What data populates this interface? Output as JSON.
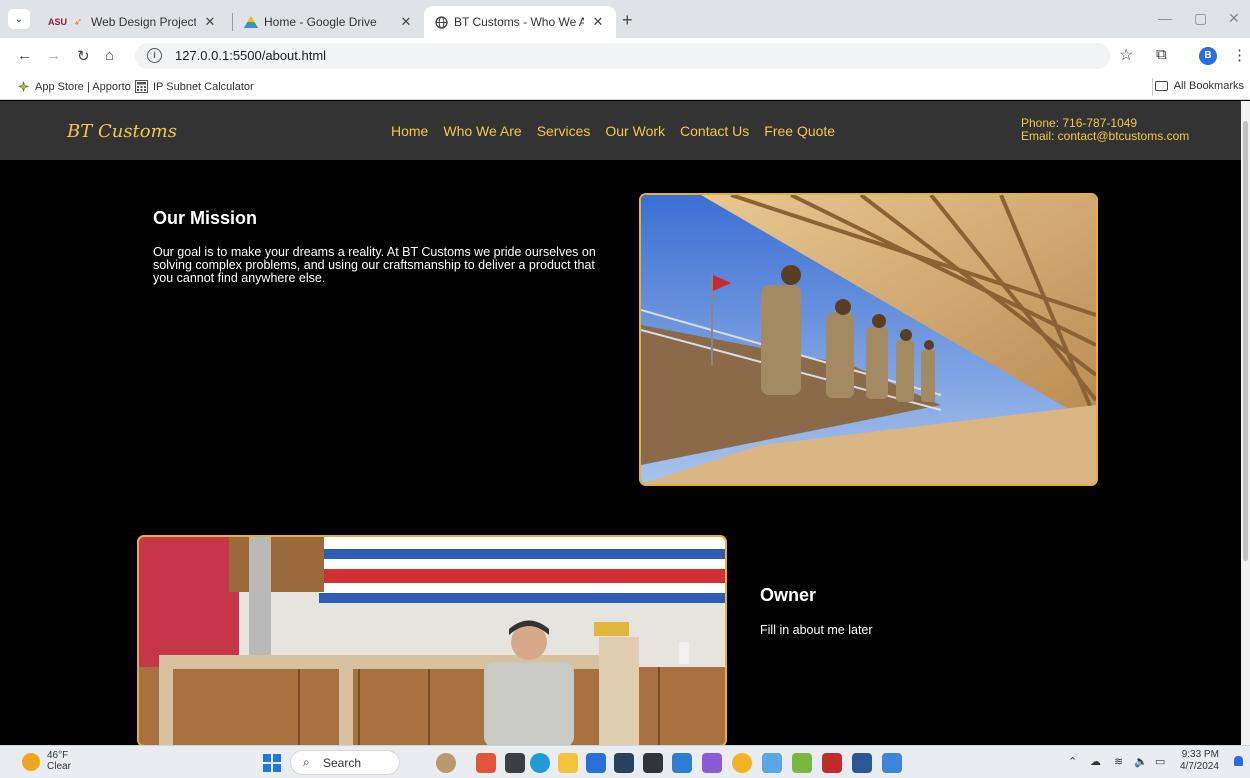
{
  "browser": {
    "tabs": [
      {
        "title": "Web Design Project - Proje",
        "favicon": "asu-logo-icon",
        "active": false
      },
      {
        "title": "Home - Google Drive",
        "favicon": "google-drive-icon",
        "active": false
      },
      {
        "title": "BT Customs - Who We Are",
        "favicon": "globe-icon",
        "active": true
      }
    ],
    "url": "127.0.0.1:5500/about.html",
    "profile_initial": "B",
    "bookmarks": [
      {
        "label": "App Store | Apporto",
        "icon": "apporto-icon"
      },
      {
        "label": "IP Subnet Calculator",
        "icon": "calculator-icon"
      }
    ],
    "all_bookmarks_label": "All Bookmarks",
    "asu_badge": "ASU"
  },
  "site": {
    "logo": "BT Customs",
    "nav": [
      "Home",
      "Who We Are",
      "Services",
      "Our Work",
      "Contact Us",
      "Free Quote"
    ],
    "phone": "Phone: 716-787-1049",
    "email": "Email: contact@btcustoms.com",
    "accent_color": "#f2c84b",
    "mission": {
      "title": "Our Mission",
      "text": "Our goal is to make your dreams a reality. At BT Customs we pride ourselves on solving complex problems, and using our craftsmanship to deliver a product that you cannot find anywhere else."
    },
    "owner": {
      "title": "Owner",
      "text": "Fill in about me later"
    }
  },
  "taskbar": {
    "temperature": "46°F",
    "condition": "Clear",
    "search_label": "Search",
    "time": "9:33 PM",
    "date": "4/7/2024"
  }
}
